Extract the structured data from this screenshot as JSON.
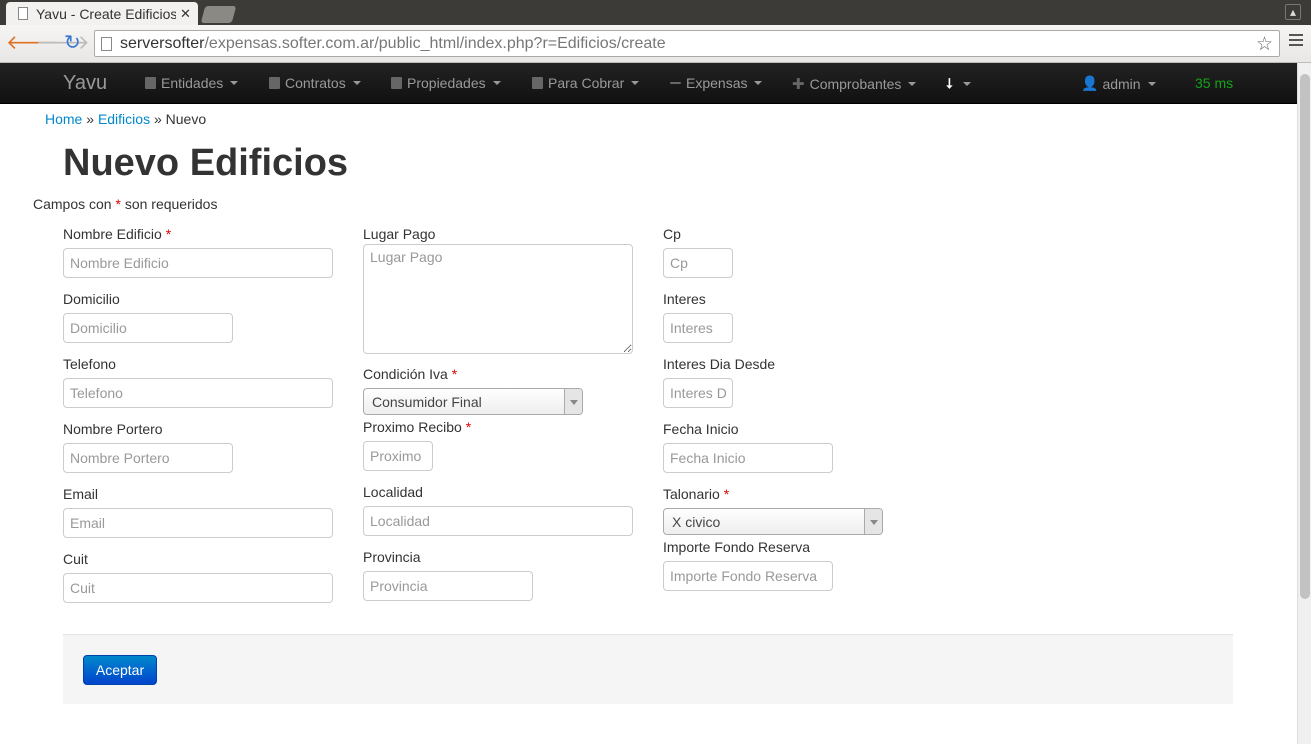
{
  "browser": {
    "tab_title": "Yavu - Create Edificios",
    "close_glyph": "✕",
    "url_host": "serversofter",
    "url_path": "/expensas.softer.com.ar/public_html/index.php?r=Edificios/create"
  },
  "navbar": {
    "brand": "Yavu",
    "items": [
      {
        "label": "Entidades",
        "icon": "user-icon"
      },
      {
        "label": "Contratos",
        "icon": "file-icon"
      },
      {
        "label": "Propiedades",
        "icon": "home-icon"
      },
      {
        "label": "Para Cobrar",
        "icon": "list-icon"
      },
      {
        "label": "Expensas",
        "icon": "minus-icon"
      },
      {
        "label": "Comprobantes",
        "icon": "plus-icon"
      },
      {
        "label": "",
        "icon": "download-icon"
      }
    ],
    "user": "admin",
    "timing": "35 ms"
  },
  "breadcrumb": {
    "home": "Home",
    "sep1": " » ",
    "edificios": "Edificios",
    "sep2": " » ",
    "current": "Nuevo"
  },
  "page_title": "Nuevo Edificios",
  "required_note": {
    "prefix": "Campos con ",
    "star": "*",
    "suffix": " son requeridos"
  },
  "form": {
    "col1": [
      {
        "label": "Nombre Edificio",
        "required": "*",
        "placeholder": "Nombre Edificio"
      },
      {
        "label": "Domicilio",
        "required": "",
        "placeholder": "Domicilio"
      },
      {
        "label": "Telefono",
        "required": "",
        "placeholder": "Telefono"
      },
      {
        "label": "Nombre Portero",
        "required": "",
        "placeholder": "Nombre Portero"
      },
      {
        "label": "Email",
        "required": "",
        "placeholder": "Email"
      },
      {
        "label": "Cuit",
        "required": "",
        "placeholder": "Cuit"
      }
    ],
    "col2": {
      "lugar_pago": {
        "label": "Lugar Pago",
        "placeholder": "Lugar Pago"
      },
      "condicion_iva": {
        "label": "Condición Iva",
        "required": "*",
        "value": "Consumidor Final"
      },
      "proximo_recibo": {
        "label": "Proximo Recibo",
        "required": "*",
        "placeholder": "Proximo"
      },
      "localidad": {
        "label": "Localidad",
        "placeholder": "Localidad"
      },
      "provincia": {
        "label": "Provincia",
        "placeholder": "Provincia"
      }
    },
    "col3": {
      "cp": {
        "label": "Cp",
        "placeholder": "Cp"
      },
      "interes": {
        "label": "Interes",
        "placeholder": "Interes"
      },
      "interes_dia": {
        "label": "Interes Dia Desde",
        "placeholder": "Interes D"
      },
      "fecha_inicio": {
        "label": "Fecha Inicio",
        "placeholder": "Fecha Inicio"
      },
      "talonario": {
        "label": "Talonario",
        "required": "*",
        "value": "X civico"
      },
      "importe_fondo": {
        "label": "Importe Fondo Reserva",
        "placeholder": "Importe Fondo Reserva"
      }
    },
    "submit": "Aceptar"
  }
}
